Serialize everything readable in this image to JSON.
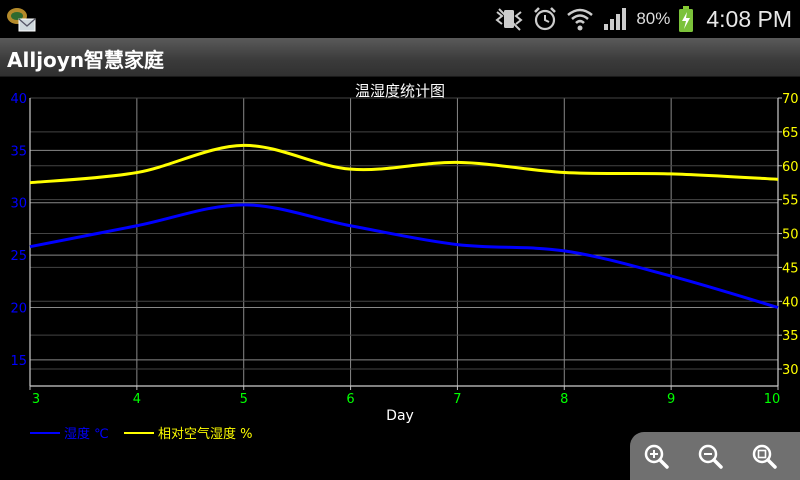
{
  "status": {
    "battery": "80%",
    "time": "4:08 PM"
  },
  "app": {
    "title": "Alljoyn智慧家庭"
  },
  "colors": {
    "temp": "#0000ff",
    "humidity": "#ffff00",
    "xticks": "#00ff00",
    "grid": "#888888"
  },
  "chart_data": {
    "type": "line",
    "title": "温湿度统计图",
    "xlabel": "Day",
    "x": [
      3,
      4,
      5,
      6,
      7,
      8,
      9,
      10
    ],
    "xlim": [
      3,
      10
    ],
    "series": [
      {
        "name": "湿度 ℃",
        "axis": "left",
        "values": [
          25.8,
          27.8,
          29.8,
          27.8,
          26.0,
          25.4,
          23.0,
          20.0
        ]
      },
      {
        "name": "相对空气湿度 %",
        "axis": "right",
        "values": [
          57.5,
          59,
          63,
          59.5,
          60.5,
          59,
          58.8,
          58
        ]
      }
    ],
    "yleft": {
      "ticks": [
        15,
        20,
        25,
        30,
        35,
        40
      ],
      "ylim": [
        12.5,
        40
      ]
    },
    "yright": {
      "ticks": [
        30,
        35,
        40,
        45,
        50,
        55,
        60,
        65,
        70
      ],
      "ylim": [
        27.5,
        70
      ]
    },
    "grid": true,
    "legend": "bottom-left"
  }
}
